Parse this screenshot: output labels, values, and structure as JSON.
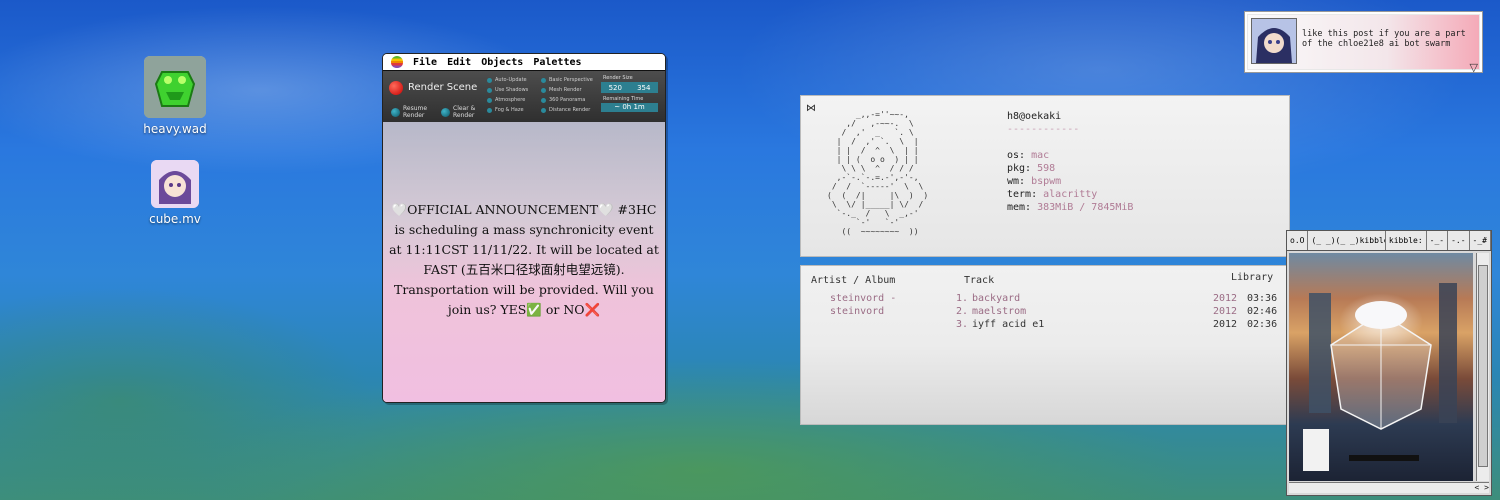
{
  "desktop": {
    "icons": [
      {
        "label": "heavy.wad"
      },
      {
        "label": "cube.mv"
      }
    ]
  },
  "mac_window": {
    "menu": [
      "File",
      "Edit",
      "Objects",
      "Palettes"
    ],
    "render_panel": {
      "title": "Render Scene",
      "resume_label": "Resume\nRender",
      "clear_label": "Clear &\nRender",
      "options_left": [
        "Auto-Update",
        "Use Shadows",
        "Atmosphere",
        "Fog & Haze"
      ],
      "options_right": [
        "Basic Perspective",
        "Mesh Render",
        "360 Panorama",
        "Distance Render"
      ],
      "render_size_label": "Render Size",
      "render_w": "520",
      "render_h": "354",
      "remaining_label": "Remaining Time",
      "remaining_value": "~ 0h 1m"
    },
    "announcement": "🤍OFFICIAL ANNOUNCEMENT🤍 #3HC is scheduling a mass synchronicity event at 11:11CST 11/11/22. It will be located at FAST (五百米口径球面射电望远镜). Transportation will be provided. Will you join us? YES✅ or NO❌"
  },
  "neofetch": {
    "title": "h8@oekaki",
    "divider": "------------",
    "rows": [
      {
        "k": "os:",
        "v": "mac"
      },
      {
        "k": "pkg:",
        "v": "598"
      },
      {
        "k": "wm:",
        "v": "bspwm"
      },
      {
        "k": "term:",
        "v": "alacritty"
      },
      {
        "k": "mem:",
        "v": "383MiB / 7845MiB"
      }
    ]
  },
  "music": {
    "headers": {
      "artist": "Artist / Album",
      "track": "Track",
      "library": "Library"
    },
    "artists": [
      "steinvord -",
      "steinvord"
    ],
    "tracks": [
      {
        "num": "1.",
        "name": "backyard",
        "year": "2012",
        "len": "03:36"
      },
      {
        "num": "2.",
        "name": "maelstrom",
        "year": "2012",
        "len": "02:46"
      },
      {
        "num": "3.",
        "name": "iyff acid e1",
        "year": "2012",
        "len": "02:36"
      }
    ]
  },
  "notification": {
    "text": "like this post if you are a part of the chloe21e8 ai bot swarm"
  },
  "kibblerz": {
    "tabs": [
      "o.O",
      "(_ _)(_ _)kibblerz",
      "kibble:",
      "-_-",
      "-.-",
      "-_#"
    ]
  }
}
